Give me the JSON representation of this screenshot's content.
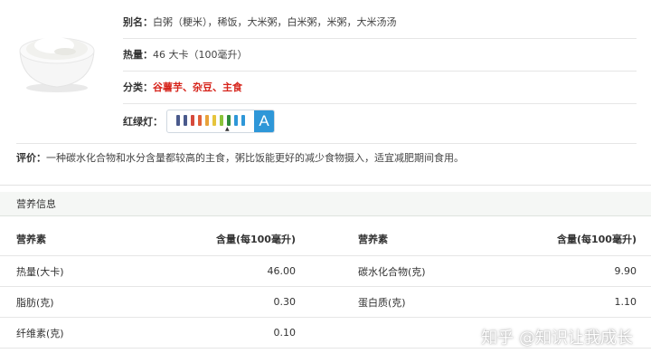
{
  "food": {
    "alias_label": "别名：",
    "alias_value": "白粥（粳米），稀饭，大米粥，白米粥，米粥，大米汤汤",
    "calorie_label": "热量：",
    "calorie_value": "46 大卡（100毫升）",
    "category_label": "分类：",
    "category_value": "谷薯芋、杂豆、主食",
    "traffic_label": "红绿灯：",
    "traffic_grade": "A",
    "traffic_colors": [
      "#4a5a8c",
      "#4a5a8c",
      "#d64a3c",
      "#e0603a",
      "#e8a23a",
      "#e6c43c",
      "#8ac43a",
      "#2e8c3c",
      "#2e97d8",
      "#2e97d8"
    ],
    "review_label": "评价：",
    "review_value": "一种碳水化合物和水分含量都较高的主食，粥比饭能更好的减少食物摄入，适宜减肥期间食用。"
  },
  "nutrition": {
    "title": "营养信息",
    "headers": [
      "营养素",
      "含量(每100毫升)",
      "营养素",
      "含量(每100毫升)"
    ],
    "rows": [
      [
        "热量(大卡)",
        "46.00",
        "碳水化合物(克)",
        "9.90"
      ],
      [
        "脂肪(克)",
        "0.30",
        "蛋白质(克)",
        "1.10"
      ],
      [
        "纤维素(克)",
        "0.10",
        "",
        ""
      ]
    ]
  },
  "watermark": "知乎 @知识让我成长"
}
